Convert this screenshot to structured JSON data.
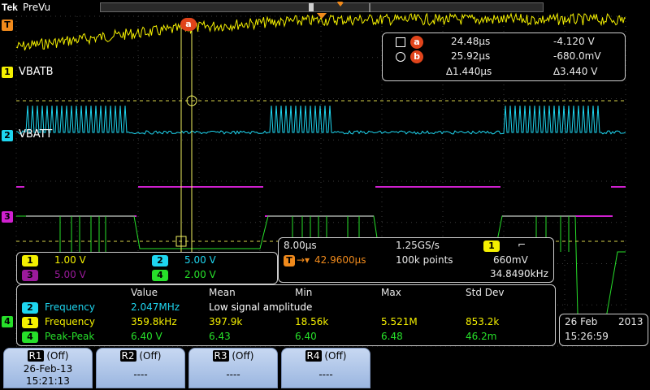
{
  "header": {
    "brand": "Tek",
    "mode": "PreVu"
  },
  "colors": {
    "ch1": "#f4f000",
    "ch2": "#1ed6f0",
    "ch3": "#d020d0",
    "ch4": "#27e02a",
    "cursor": "#f0f060",
    "marker": "#e0441b",
    "trigger": "#f08a1c"
  },
  "channels": {
    "ch1": {
      "number": "1",
      "name": "VBATB",
      "scale": "1.00 V"
    },
    "ch2": {
      "number": "2",
      "name": "VBATT",
      "scale": "5.00 V"
    },
    "ch3": {
      "number": "3",
      "scale": "5.00 V"
    },
    "ch4": {
      "number": "4",
      "scale": "2.00 V"
    }
  },
  "trigger_marker": "T",
  "cursors": {
    "a_label": "a",
    "b_label": "b",
    "a_time": "24.48µs",
    "a_value": "-4.120 V",
    "b_time": "25.92µs",
    "b_value": "-680.0mV",
    "delta_time": "∆1.440µs",
    "delta_value": "∆3.440 V"
  },
  "timebase": {
    "horizontal_scale": "8.00µs",
    "sample_rate": "1.25GS/s",
    "trigger_source": "1",
    "trigger_slope": "⌐",
    "trigger_delay": "42.9600µs",
    "record_length": "100k points",
    "trigger_level": "660mV",
    "trigger_frequency": "34.8490kHz"
  },
  "measurements": {
    "headers": [
      "Value",
      "Mean",
      "Min",
      "Max",
      "Std Dev"
    ],
    "rows": [
      {
        "channel": "2",
        "type": "Frequency",
        "value": "2.047MHz",
        "mean": "Low signal amplitude",
        "min": "",
        "max": "",
        "std": ""
      },
      {
        "channel": "1",
        "type": "Frequency",
        "value": "359.8kHz",
        "mean": "397.9k",
        "min": "18.56k",
        "max": "5.521M",
        "std": "853.2k"
      },
      {
        "channel": "4",
        "type": "Peak-Peak",
        "value": "6.40 V",
        "mean": "6.43",
        "min": "6.40",
        "max": "6.48",
        "std": "46.2m"
      }
    ]
  },
  "datetime": {
    "date": "26 Feb",
    "year": "2013",
    "time": "15:26:59"
  },
  "references": [
    {
      "id": "R1",
      "state": "(Off)",
      "date": "26-Feb-13",
      "time": "15:21:13"
    },
    {
      "id": "R2",
      "state": "(Off)",
      "line": "----"
    },
    {
      "id": "R3",
      "state": "(Off)",
      "line": "----"
    },
    {
      "id": "R4",
      "state": "(Off)",
      "line": "----"
    }
  ]
}
